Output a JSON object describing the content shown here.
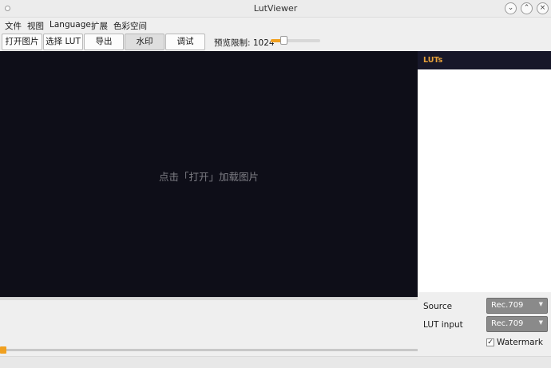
{
  "window": {
    "title": "LutViewer"
  },
  "menu": {
    "items": [
      "文件",
      "视图",
      "Language",
      "扩展",
      "色彩空间"
    ]
  },
  "toolbar": {
    "buttons": [
      "打开图片",
      "选择 LUT",
      "导出",
      "水印",
      "调试"
    ],
    "active_button": "水印",
    "limit_label": "预览限制: 1024",
    "limit_slider_fraction": 0.25
  },
  "preview": {
    "hint": "点击「打开」加载图片"
  },
  "lut_panel": {
    "header": "LUTs"
  },
  "settings": {
    "source_label": "Source",
    "source_value": "Rec.709",
    "lut_input_label": "LUT input",
    "lut_input_value": "Rec.709",
    "watermark_label": "Watermark",
    "watermark_checked": true
  },
  "timeline": {
    "position_fraction": 0.0
  },
  "colors": {
    "accent": "#f0a020",
    "preview_bg": "#0e0e18",
    "lut_header_bg": "#171729",
    "lut_header_text": "#e8a23a"
  }
}
